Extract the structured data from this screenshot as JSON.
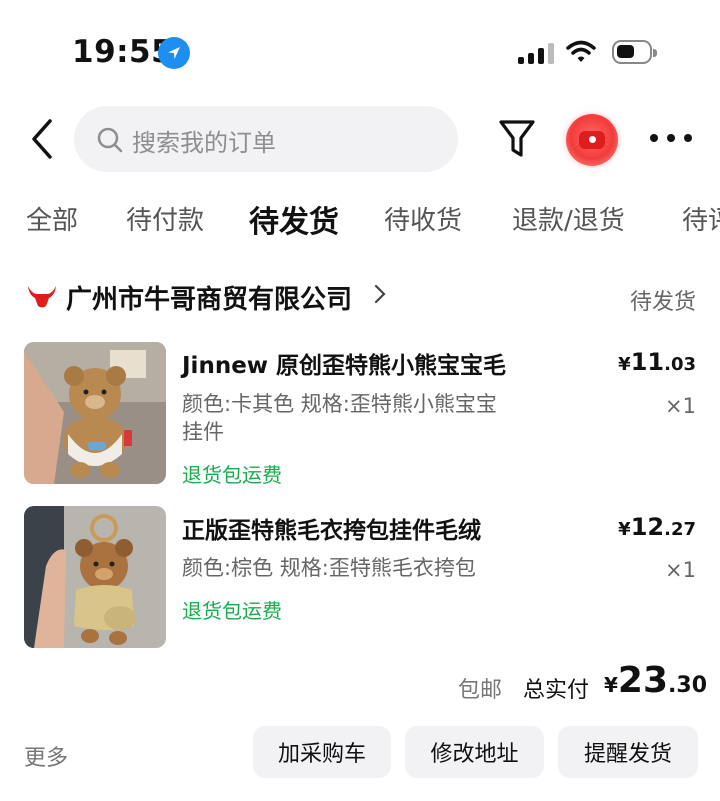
{
  "status_bar": {
    "time": "19:55"
  },
  "header": {
    "search_placeholder": "搜索我的订单"
  },
  "tabs": [
    "全部",
    "待付款",
    "待发货",
    "待收货",
    "退款/退货",
    "待评"
  ],
  "store": {
    "name": "广州市牛哥商贸有限公司",
    "status": "待发货"
  },
  "items": [
    {
      "title": "Jinnew 原创歪特熊小熊宝宝毛",
      "spec_line1": "颜色:卡其色 规格:歪特熊小熊宝宝",
      "spec_line2": "挂件",
      "shipping": "退货包运费",
      "currency": "¥",
      "price_int": "11",
      "price_dec": ".03",
      "qty": "×1"
    },
    {
      "title": "正版歪特熊毛衣挎包挂件毛绒",
      "spec_line1": "颜色:棕色 规格:歪特熊毛衣挎包",
      "spec_line2": "",
      "shipping": "退货包运费",
      "currency": "¥",
      "price_int": "12",
      "price_dec": ".27",
      "qty": "×1"
    }
  ],
  "summary": {
    "free_shipping": "包邮",
    "paid_label": "总实付",
    "currency": "¥",
    "total_int": "23",
    "total_dec": ".30"
  },
  "actions": {
    "more": "更多",
    "add_cart": "加采购车",
    "change_address": "修改地址",
    "remind_ship": "提醒发货"
  },
  "colors": {
    "accent_red": "#e01d1d",
    "green": "#1aab4f",
    "location_blue": "#1f8ef1"
  }
}
